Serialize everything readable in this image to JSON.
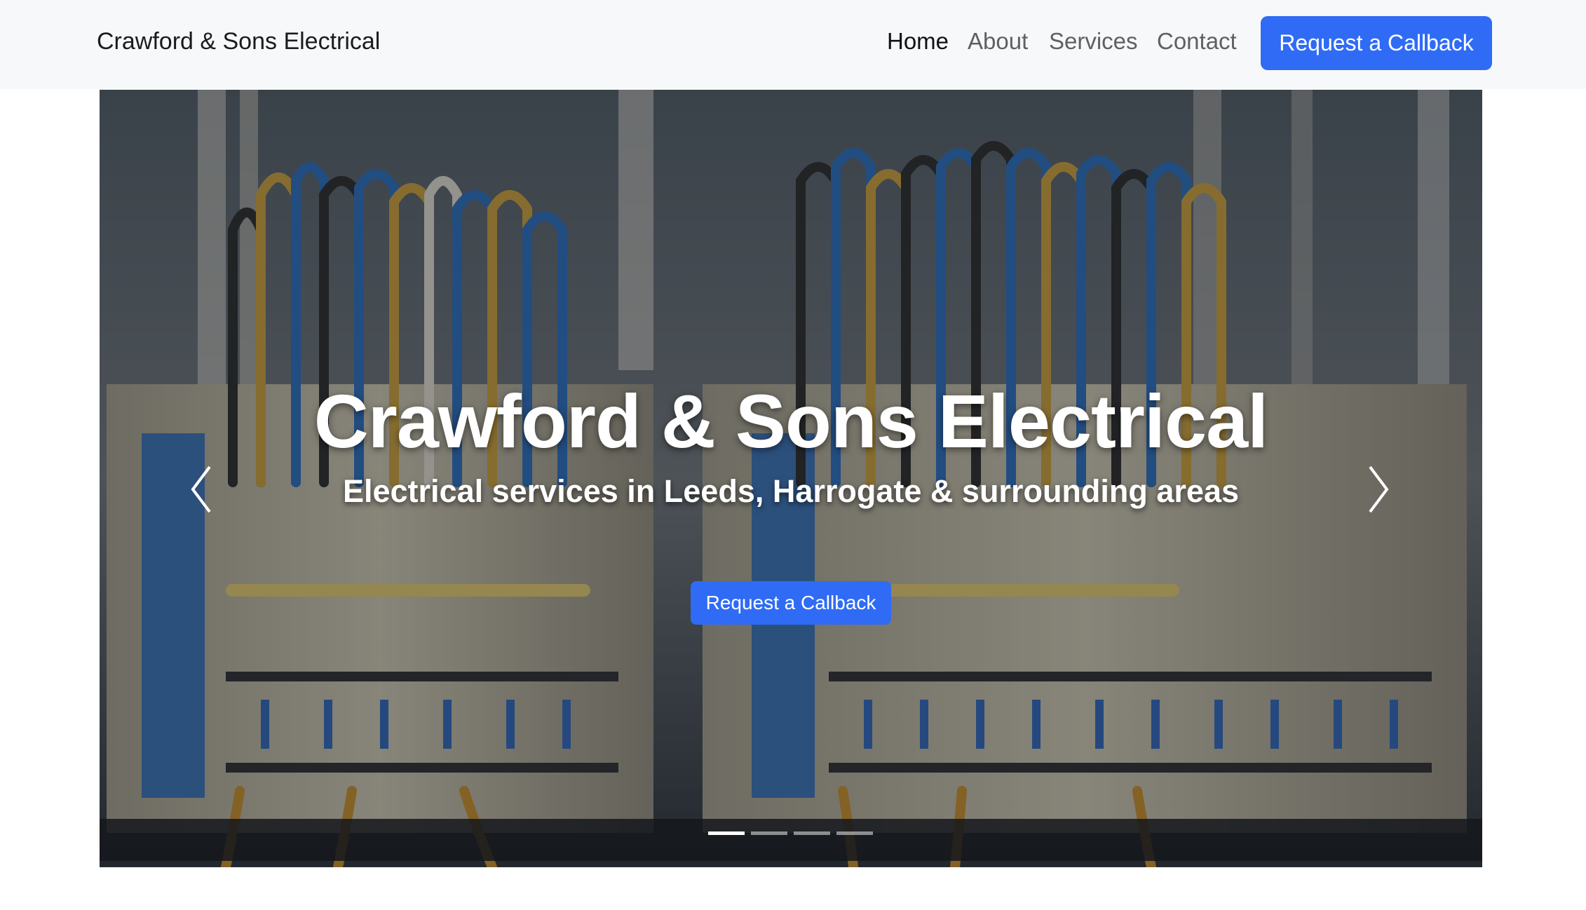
{
  "navbar": {
    "brand": "Crawford & Sons Electrical",
    "links": [
      {
        "label": "Home",
        "active": true
      },
      {
        "label": "About",
        "active": false
      },
      {
        "label": "Services",
        "active": false
      },
      {
        "label": "Contact",
        "active": false
      }
    ],
    "cta_label": "Request a Callback"
  },
  "hero": {
    "title": "Crawford & Sons Electrical",
    "subtitle": "Electrical services in Leeds, Harrogate & surrounding areas",
    "cta_label": "Request a Callback",
    "prev_icon": "chevron-left-icon",
    "next_icon": "chevron-right-icon",
    "indicators": [
      {
        "active": true
      },
      {
        "active": false
      },
      {
        "active": false
      },
      {
        "active": false
      }
    ]
  },
  "colors": {
    "primary": "#2f6bf5",
    "navbar_bg": "#f7f8f9",
    "nav_text": "#5e6064",
    "nav_active": "#111111"
  }
}
